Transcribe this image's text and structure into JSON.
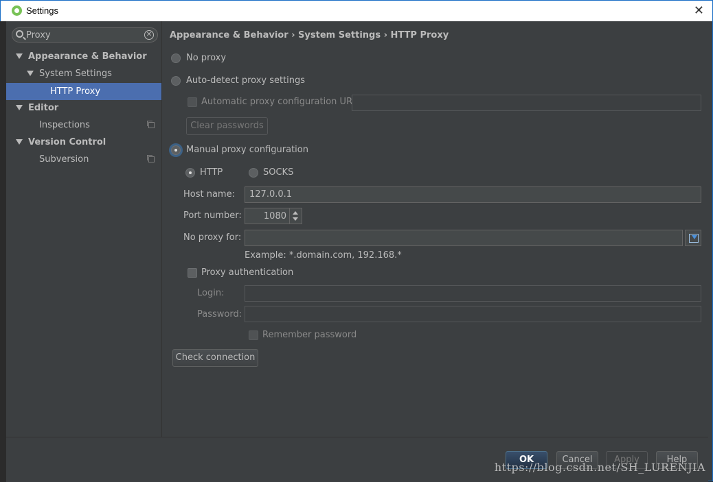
{
  "window": {
    "title": "Settings"
  },
  "search": {
    "value": "Proxy"
  },
  "sidebar": {
    "items": [
      {
        "label": "Appearance & Behavior"
      },
      {
        "label": "System Settings"
      },
      {
        "label": "HTTP Proxy"
      },
      {
        "label": "Editor"
      },
      {
        "label": "Inspections"
      },
      {
        "label": "Version Control"
      },
      {
        "label": "Subversion"
      }
    ]
  },
  "breadcrumb": "Appearance & Behavior › System Settings › HTTP Proxy",
  "proxy": {
    "no_proxy_label": "No proxy",
    "auto_detect_label": "Auto-detect proxy settings",
    "auto_url_label": "Automatic proxy configuration URL:",
    "auto_url_value": "",
    "clear_passwords_label": "Clear passwords",
    "manual_label": "Manual proxy configuration",
    "http_label": "HTTP",
    "socks_label": "SOCKS",
    "host_label": "Host name:",
    "host_value": "127.0.0.1",
    "port_label": "Port number:",
    "port_value": "1080",
    "no_proxy_for_label": "No proxy for:",
    "no_proxy_for_value": "",
    "example_text": "Example: *.domain.com, 192.168.*",
    "auth_label": "Proxy authentication",
    "login_label": "Login:",
    "login_value": "",
    "password_label": "Password:",
    "password_value": "",
    "remember_label": "Remember password",
    "check_connection_label": "Check connection",
    "selected_mode": "manual",
    "selected_protocol": "HTTP"
  },
  "footer": {
    "ok_label": "OK",
    "cancel_label": "Cancel",
    "apply_label": "Apply",
    "help_label": "Help"
  },
  "watermark": "https://blog.csdn.net/SH_LURENJIA",
  "colors": {
    "selection": "#4b6eaf",
    "background": "#3c3f41",
    "titlebar": "#ffffff"
  }
}
